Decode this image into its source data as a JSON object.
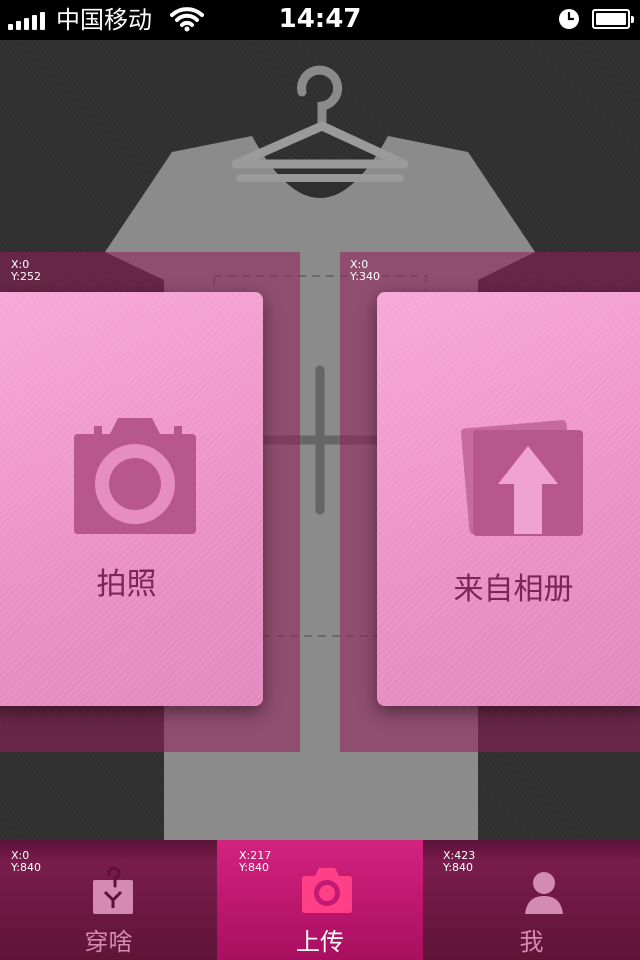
{
  "status_bar": {
    "carrier": "中国移动",
    "time": "14:47"
  },
  "cards": {
    "camera": {
      "label": "拍照",
      "icon": "camera-icon"
    },
    "album": {
      "label": "来自相册",
      "icon": "upload-photo-icon"
    }
  },
  "coordinates": {
    "left_band": "X:0\nY:252",
    "right_band": "X:0\nY:340",
    "tab_1": "X:0\nY:840",
    "tab_2": "X:217\nY:840",
    "tab_3": "X:423\nY:840"
  },
  "tabs": [
    {
      "label": "穿啥",
      "icon": "hanger-tag-icon",
      "active": false
    },
    {
      "label": "上传",
      "icon": "camera-icon",
      "active": true
    },
    {
      "label": "我",
      "icon": "user-icon",
      "active": false
    }
  ],
  "colors": {
    "accent": "#c21a72",
    "card": "#f0a0d0",
    "card_text": "#7a2656",
    "tab_inactive": "#d48bb1"
  }
}
